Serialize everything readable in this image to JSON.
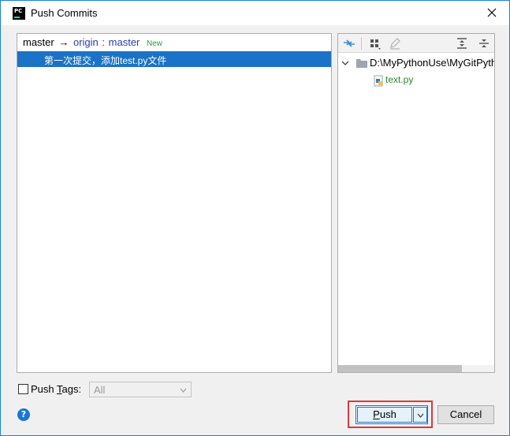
{
  "window": {
    "title": "Push Commits",
    "app_icon_text": "PC"
  },
  "commits": {
    "branch": {
      "local": "master",
      "arrow": "→",
      "remote": "origin",
      "separator": ":",
      "target": "master",
      "badge": "New"
    },
    "items": [
      {
        "message": "第一次提交，添加test.py文件",
        "selected": true
      }
    ]
  },
  "files": {
    "toolbar": {
      "icons": [
        "show-diff-icon",
        "group-by-icon",
        "edit-icon",
        "expand-all-icon",
        "collapse-all-icon"
      ]
    },
    "root": {
      "label": "D:\\MyPythonUse\\MyGitPyth",
      "expanded": true
    },
    "children": [
      {
        "label": "text.py",
        "icon": "python-file-icon"
      }
    ]
  },
  "options": {
    "push_tags_label_prefix": "Push ",
    "push_tags_label_mnemonic": "T",
    "push_tags_label_suffix": "ags:",
    "push_tags_checked": false,
    "tags_select_value": "All"
  },
  "buttons": {
    "push_mnemonic": "P",
    "push_rest": "ush",
    "cancel": "Cancel",
    "help": "?"
  },
  "colors": {
    "selection": "#1a73c6",
    "remote_branch": "#2a3cb5",
    "new_badge": "#29a329",
    "file_name": "#2c8a2c",
    "highlight": "#d93a3a"
  }
}
